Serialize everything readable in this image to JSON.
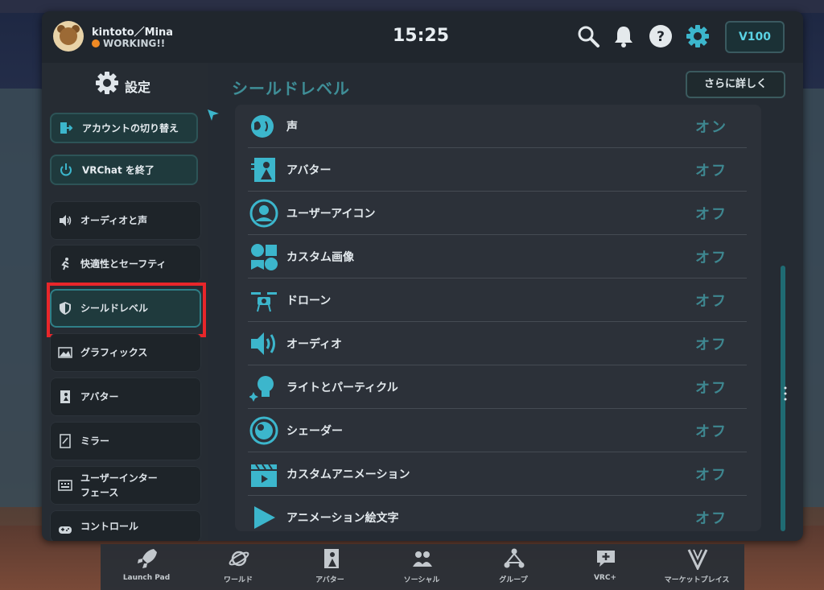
{
  "header": {
    "username": "kintoto／Mina",
    "status": "WORKING!!",
    "time": "15:25",
    "credits": "V100",
    "status_color": "#f08a24"
  },
  "sidebar": {
    "title": "設定",
    "account_switch": "アカウントの切り替え",
    "quit": "VRChat を終了",
    "items": [
      {
        "label": "オーディオと声",
        "icon": "speaker-icon"
      },
      {
        "label": "快適性とセーフティ",
        "icon": "running-person-icon"
      },
      {
        "label": "シールドレベル",
        "icon": "shield-icon",
        "active": true
      },
      {
        "label": "グラフィックス",
        "icon": "landscape-image-icon"
      },
      {
        "label": "アバター",
        "icon": "avatar-icon"
      },
      {
        "label": "ミラー",
        "icon": "mirror-icon"
      },
      {
        "label": "ユーザーインター\nフェース",
        "icon": "keyboard-icon"
      },
      {
        "label": "コントロール",
        "icon": "gamepad-icon"
      }
    ]
  },
  "main": {
    "title": "シールドレベル",
    "more_button": "さらに詳しく",
    "rows": [
      {
        "label": "声",
        "value": "オン",
        "icon": "voice-icon"
      },
      {
        "label": "アバター",
        "value": "オフ",
        "icon": "avatar-icon"
      },
      {
        "label": "ユーザーアイコン",
        "value": "オフ",
        "icon": "user-icon"
      },
      {
        "label": "カスタム画像",
        "value": "オフ",
        "icon": "custom-image-icon"
      },
      {
        "label": "ドローン",
        "value": "オフ",
        "icon": "drone-icon"
      },
      {
        "label": "オーディオ",
        "value": "オフ",
        "icon": "speaker-icon"
      },
      {
        "label": "ライトとパーティクル",
        "value": "オフ",
        "icon": "lightbulb-icon"
      },
      {
        "label": "シェーダー",
        "value": "オフ",
        "icon": "shader-icon"
      },
      {
        "label": "カスタムアニメーション",
        "value": "オフ",
        "icon": "clapperboard-icon"
      },
      {
        "label": "アニメーション絵文字",
        "value": "オフ",
        "icon": "play-icon"
      }
    ]
  },
  "dock": [
    {
      "label": "Launch Pad",
      "icon": "rocket-icon"
    },
    {
      "label": "ワールド",
      "icon": "planet-icon"
    },
    {
      "label": "アバター",
      "icon": "avatar-icon"
    },
    {
      "label": "ソーシャル",
      "icon": "people-icon"
    },
    {
      "label": "グループ",
      "icon": "group-icon"
    },
    {
      "label": "VRC+",
      "icon": "vrc-plus-icon"
    },
    {
      "label": "マーケットプレイス",
      "icon": "marketplace-icon"
    }
  ],
  "colors": {
    "accent": "#3e8790",
    "highlight": "#e8262a"
  }
}
